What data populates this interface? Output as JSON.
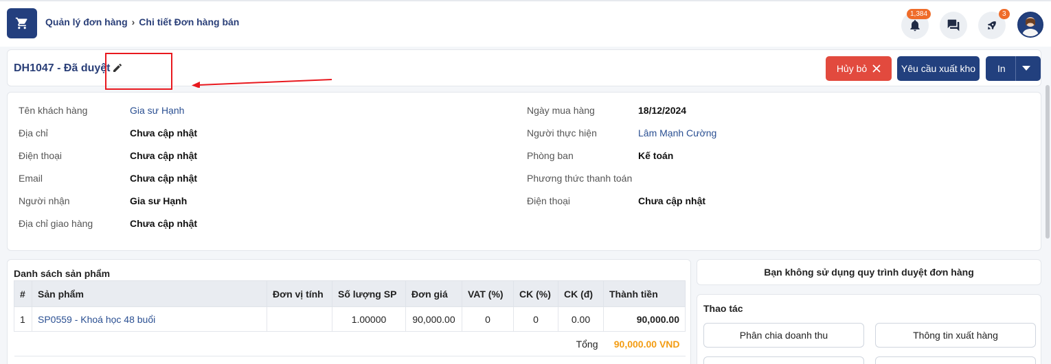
{
  "header": {
    "breadcrumb": [
      "Quản lý đơn hàng",
      "Chi tiết Đơn hàng bán"
    ],
    "notifications_badge": "1,384",
    "rocket_badge": "3"
  },
  "order": {
    "title": "DH1047 - Đã duyệt",
    "buttons": {
      "cancel": "Hủy bỏ",
      "export_request": "Yêu cầu xuất kho",
      "print": "In"
    }
  },
  "info": {
    "left": [
      {
        "label": "Tên khách hàng",
        "value": "Gia sư Hạnh",
        "link": true
      },
      {
        "label": "Địa chỉ",
        "value": "Chưa cập nhật"
      },
      {
        "label": "Điện thoại",
        "value": "Chưa cập nhật"
      },
      {
        "label": "Email",
        "value": "Chưa cập nhật"
      },
      {
        "label": "Người nhận",
        "value": "Gia sư Hạnh"
      },
      {
        "label": "Địa chỉ giao hàng",
        "value": "Chưa cập nhật"
      }
    ],
    "right": [
      {
        "label": "Ngày mua hàng",
        "value": "18/12/2024"
      },
      {
        "label": "Người thực hiện",
        "value": "Lâm Mạnh Cường",
        "link": true
      },
      {
        "label": "Phòng ban",
        "value": "Kế toán"
      },
      {
        "label": "Phương thức thanh toán",
        "value": ""
      },
      {
        "label": "Điện thoại",
        "value": "Chưa cập nhật"
      }
    ]
  },
  "products": {
    "title": "Danh sách sản phẩm",
    "columns": [
      "#",
      "Sản phẩm",
      "Đơn vị tính",
      "Số lượng SP",
      "Đơn giá",
      "VAT (%)",
      "CK (%)",
      "CK (đ)",
      "Thành tiền"
    ],
    "rows": [
      [
        "1",
        "SP0559 - Khoá học 48 buổi",
        "",
        "1.00000",
        "90,000.00",
        "0",
        "0",
        "0.00",
        "90,000.00"
      ]
    ],
    "total_label": "Tổng",
    "total_value": "90,000.00 VND"
  },
  "notice": "Bạn không sử dụng quy trình duyệt đơn hàng",
  "actions": {
    "title": "Thao tác",
    "items": [
      "Phân chia doanh thu",
      "Thông tin xuất hàng"
    ]
  },
  "colors": {
    "primary": "#22407e",
    "danger": "#e24a3e",
    "accent": "#f39c12",
    "annotation": "#e8181e"
  }
}
